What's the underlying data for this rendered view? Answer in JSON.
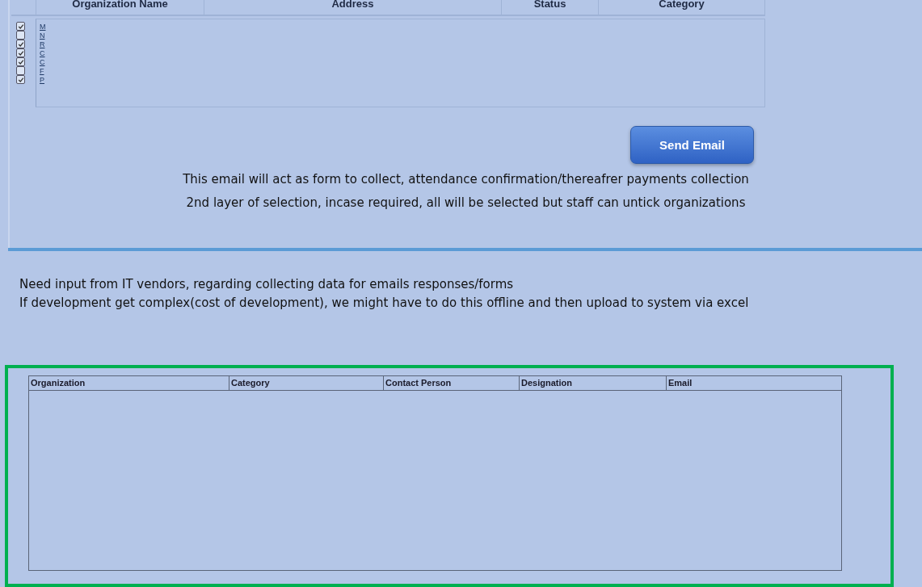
{
  "selection_table": {
    "columns": [
      "Organization Name",
      "Address",
      "Status",
      "Category"
    ],
    "rows": [
      {
        "checked": true,
        "organization": "M"
      },
      {
        "checked": false,
        "organization": "N"
      },
      {
        "checked": true,
        "organization": "R"
      },
      {
        "checked": true,
        "organization": "C"
      },
      {
        "checked": true,
        "organization": "C"
      },
      {
        "checked": false,
        "organization": "F"
      },
      {
        "checked": true,
        "organization": "P"
      }
    ]
  },
  "send_button": "Send Email",
  "notes": [
    "This email will act as form to collect, attendance confirmation/thereafrer payments collection",
    "2nd layer of selection, incase required, all will be selected but staff can untick organizations"
  ],
  "vendor_notes": [
    "Need input from IT vendors, regarding collecting data for emails responses/forms",
    "If development get complex(cost of development), we might have to do this offline and then upload to system via excel"
  ],
  "contact_table": {
    "columns": [
      "Organization",
      "Category",
      "Contact Person",
      "Designation",
      "Email"
    ]
  }
}
